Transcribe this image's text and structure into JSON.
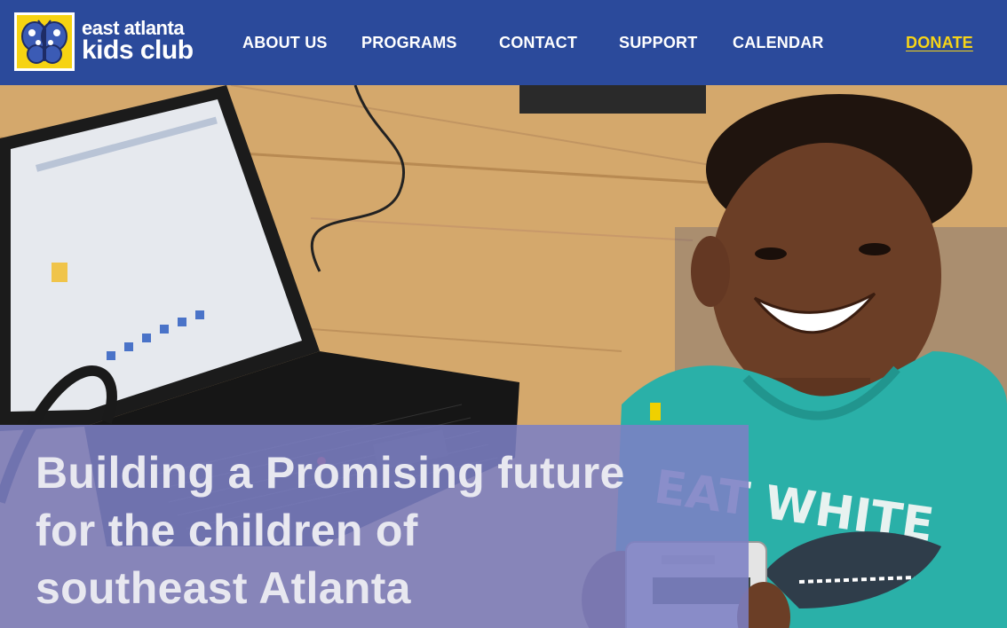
{
  "site": {
    "logo_line1": "east atlanta",
    "logo_line2": "kids club"
  },
  "nav": {
    "about": "ABOUT US",
    "programs": "PROGRAMS",
    "contact": "CONTACT",
    "support": "SUPPORT",
    "calendar": "CALENDAR",
    "donate": "DONATE"
  },
  "hero": {
    "headline": "Building a Promising future for the children of southeast Atlanta",
    "image_subject": "boy-with-laptop-and-robot-kit",
    "shirt_text": "EAT WHITE"
  },
  "colors": {
    "header_bg": "#2b4a9b",
    "donate": "#f7d417",
    "headline_overlay": "#7c80c4",
    "shirt": "#2ab0a8"
  }
}
